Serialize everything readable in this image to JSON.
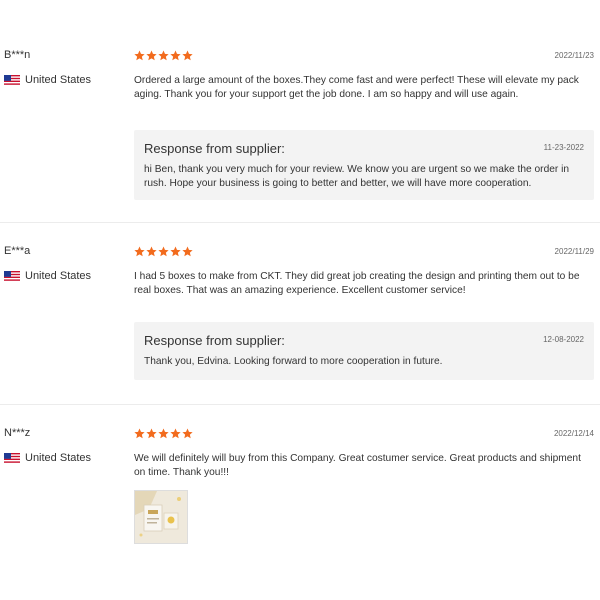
{
  "reviews": [
    {
      "user": "B***n",
      "country": "United States",
      "rating": 5,
      "date": "2022/11/23",
      "text": "Ordered a large amount of the boxes.They come fast and were perfect! These will elevate my pack aging. Thank you for your support get the job done. I am so happy and will use again.",
      "response": {
        "title": "Response from supplier:",
        "date": "11-23-2022",
        "text": "hi Ben, thank you very much for your review. We know you are urgent so we make the order in rush. Hope your business is going to better and better, we will have more cooperation."
      }
    },
    {
      "user": "E***a",
      "country": "United States",
      "rating": 5,
      "date": "2022/11/29",
      "text": "I had 5 boxes to make from CKT. They did great job creating the design and printing them out to be real boxes. That was an amazing experience. Excellent customer service!",
      "response": {
        "title": "Response from supplier:",
        "date": "12-08-2022",
        "text": "Thank you, Edvina. Looking forward to more cooperation in future."
      }
    },
    {
      "user": "N***z",
      "country": "United States",
      "rating": 5,
      "date": "2022/12/14",
      "text": "We will definitely will buy from this Company. Great costumer service. Great products and shipment on time. Thank you!!!",
      "has_photo": true
    }
  ],
  "colors": {
    "star": "#f26b1d",
    "response_bg": "#f3f3f3",
    "text": "#333333",
    "muted": "#666666"
  },
  "icons": {
    "rating": "star-icon",
    "country": "us-flag-icon",
    "photo": "review-photo"
  }
}
